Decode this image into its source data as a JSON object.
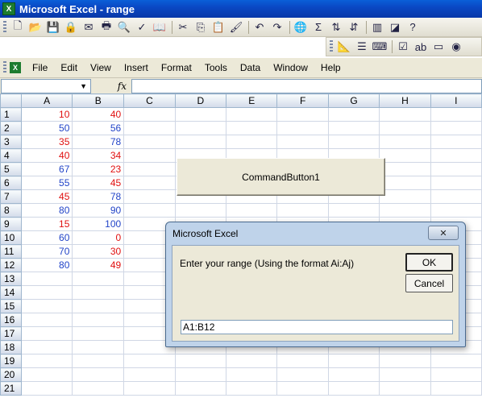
{
  "window": {
    "title": "Microsoft Excel - range",
    "app_icon": "excel-icon"
  },
  "menu": [
    "File",
    "Edit",
    "View",
    "Insert",
    "Format",
    "Tools",
    "Data",
    "Window",
    "Help"
  ],
  "formula_bar": {
    "name_box": "",
    "fx_label": "fx",
    "formula": ""
  },
  "columns": [
    "A",
    "B",
    "C",
    "D",
    "E",
    "F",
    "G",
    "H",
    "I"
  ],
  "rows": [
    {
      "n": "1",
      "a": "10",
      "a_color": "red",
      "b": "40",
      "b_color": "red"
    },
    {
      "n": "2",
      "a": "50",
      "a_color": "blue",
      "b": "56",
      "b_color": "blue"
    },
    {
      "n": "3",
      "a": "35",
      "a_color": "red",
      "b": "78",
      "b_color": "blue"
    },
    {
      "n": "4",
      "a": "40",
      "a_color": "red",
      "b": "34",
      "b_color": "red"
    },
    {
      "n": "5",
      "a": "67",
      "a_color": "blue",
      "b": "23",
      "b_color": "red"
    },
    {
      "n": "6",
      "a": "55",
      "a_color": "blue",
      "b": "45",
      "b_color": "red"
    },
    {
      "n": "7",
      "a": "45",
      "a_color": "red",
      "b": "78",
      "b_color": "blue"
    },
    {
      "n": "8",
      "a": "80",
      "a_color": "blue",
      "b": "90",
      "b_color": "blue"
    },
    {
      "n": "9",
      "a": "15",
      "a_color": "red",
      "b": "100",
      "b_color": "blue"
    },
    {
      "n": "10",
      "a": "60",
      "a_color": "blue",
      "b": "0",
      "b_color": "red"
    },
    {
      "n": "11",
      "a": "70",
      "a_color": "blue",
      "b": "30",
      "b_color": "red"
    },
    {
      "n": "12",
      "a": "80",
      "a_color": "blue",
      "b": "49",
      "b_color": "red"
    },
    {
      "n": "13",
      "a": "",
      "a_color": "",
      "b": "",
      "b_color": ""
    },
    {
      "n": "14",
      "a": "",
      "a_color": "",
      "b": "",
      "b_color": ""
    },
    {
      "n": "15",
      "a": "",
      "a_color": "",
      "b": "",
      "b_color": ""
    },
    {
      "n": "16",
      "a": "",
      "a_color": "",
      "b": "",
      "b_color": ""
    },
    {
      "n": "17",
      "a": "",
      "a_color": "",
      "b": "",
      "b_color": ""
    },
    {
      "n": "18",
      "a": "",
      "a_color": "",
      "b": "",
      "b_color": ""
    },
    {
      "n": "19",
      "a": "",
      "a_color": "",
      "b": "",
      "b_color": ""
    },
    {
      "n": "20",
      "a": "",
      "a_color": "",
      "b": "",
      "b_color": ""
    },
    {
      "n": "21",
      "a": "",
      "a_color": "",
      "b": "",
      "b_color": ""
    }
  ],
  "colors": {
    "red": "#e01010",
    "blue": "#2244c8"
  },
  "command_button": {
    "label": "CommandButton1"
  },
  "dialog": {
    "title": "Microsoft Excel",
    "prompt": "Enter your range (Using the format Ai:Aj)",
    "ok_label": "OK",
    "cancel_label": "Cancel",
    "input_value": "A1:B12",
    "close_glyph": "✕"
  }
}
